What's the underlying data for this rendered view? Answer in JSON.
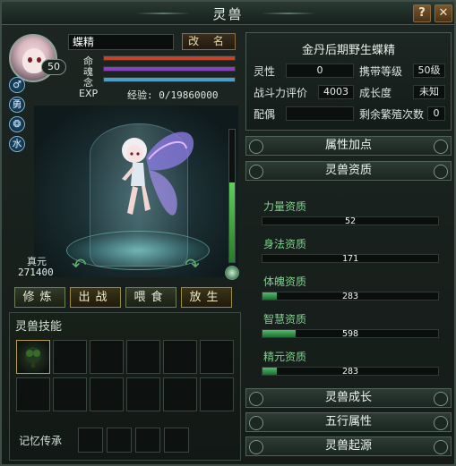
{
  "window": {
    "title": "灵兽",
    "help_label": "?",
    "close_label": "✕"
  },
  "pet": {
    "name": "蝶精",
    "level": "50",
    "rename_label": "改 名",
    "stats": [
      {
        "label": "命",
        "fill": 1.0,
        "color": "#c2442b"
      },
      {
        "label": "魂",
        "fill": 1.0,
        "color": "#8a3fc2"
      },
      {
        "label": "念",
        "fill": 1.0,
        "color": "#4c9ec7"
      }
    ],
    "exp_label": "EXP",
    "exp_text": "经验: 0/19860000",
    "exp_fill": 0.0,
    "side_icons": [
      {
        "icon": "male-icon",
        "glyph": "♂"
      },
      {
        "icon": "brave-icon",
        "glyph": "勇"
      },
      {
        "icon": "skill-orb-icon",
        "glyph": "❂"
      },
      {
        "icon": "water-element-icon",
        "glyph": "水"
      }
    ],
    "zhenyuan_label": "真元",
    "zhenyuan_value": "271400",
    "vertical_gauge_fill": 0.6
  },
  "actions": [
    {
      "label": "修炼",
      "style": "normal"
    },
    {
      "label": "出战",
      "style": "gold"
    },
    {
      "label": "喂食",
      "style": "normal"
    },
    {
      "label": "放生",
      "style": "gold"
    }
  ],
  "skills": {
    "title": "灵兽技能",
    "memory_title": "记忆传承"
  },
  "info": {
    "title": "金丹后期野生蝶精",
    "lingxing_label": "灵性",
    "lingxing_value": "0",
    "carry_label": "携带等级",
    "carry_value": "50级",
    "power_label": "战斗力评价",
    "power_value": "4003",
    "growth_label": "成长度",
    "growth_value": "未知",
    "mate_label": "配偶",
    "mate_value": "",
    "breed_label": "剩余繁殖次数",
    "breed_value": "0"
  },
  "sections": {
    "attr_bonus": "属性加点",
    "pet_aptitude": "灵兽资质",
    "pet_growth": "灵兽成长",
    "five_elements": "五行属性",
    "pet_origin": "灵兽起源"
  },
  "aptitudes": [
    {
      "name": "力量资质",
      "value": "52",
      "fill": 0.0
    },
    {
      "name": "身法资质",
      "value": "171",
      "fill": 0.0
    },
    {
      "name": "体魄资质",
      "value": "283",
      "fill": 0.08
    },
    {
      "name": "智慧资质",
      "value": "598",
      "fill": 0.19
    },
    {
      "name": "精元资质",
      "value": "283",
      "fill": 0.08
    }
  ]
}
